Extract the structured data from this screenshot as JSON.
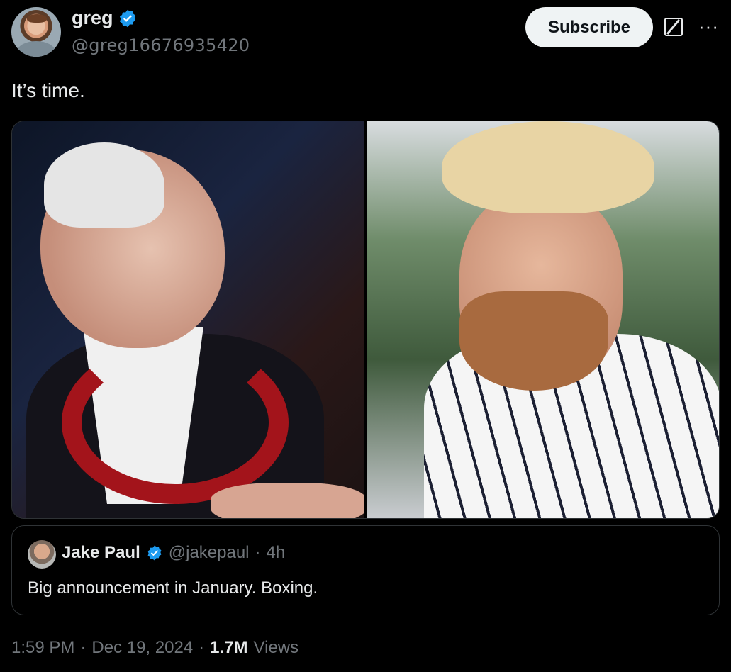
{
  "author": {
    "name": "greg",
    "handle": "@greg16676935420"
  },
  "actions": {
    "subscribe_label": "Subscribe",
    "more_label": "···"
  },
  "tweet": {
    "text": "It’s time."
  },
  "quote": {
    "name": "Jake Paul",
    "handle": "@jakepaul",
    "separator": "·",
    "age": "4h",
    "text": "Big announcement in January. Boxing."
  },
  "meta": {
    "time": "1:59 PM",
    "sep1": "·",
    "date": "Dec 19, 2024",
    "sep2": "·",
    "views_count": "1.7M",
    "views_label": "Views"
  },
  "colors": {
    "background": "#000000",
    "text": "#e7e9ea",
    "muted": "#71767b",
    "verified": "#1d9bf0",
    "border": "#2f3336"
  },
  "icons": [
    "verified-badge-icon",
    "grok-icon",
    "more-icon"
  ]
}
